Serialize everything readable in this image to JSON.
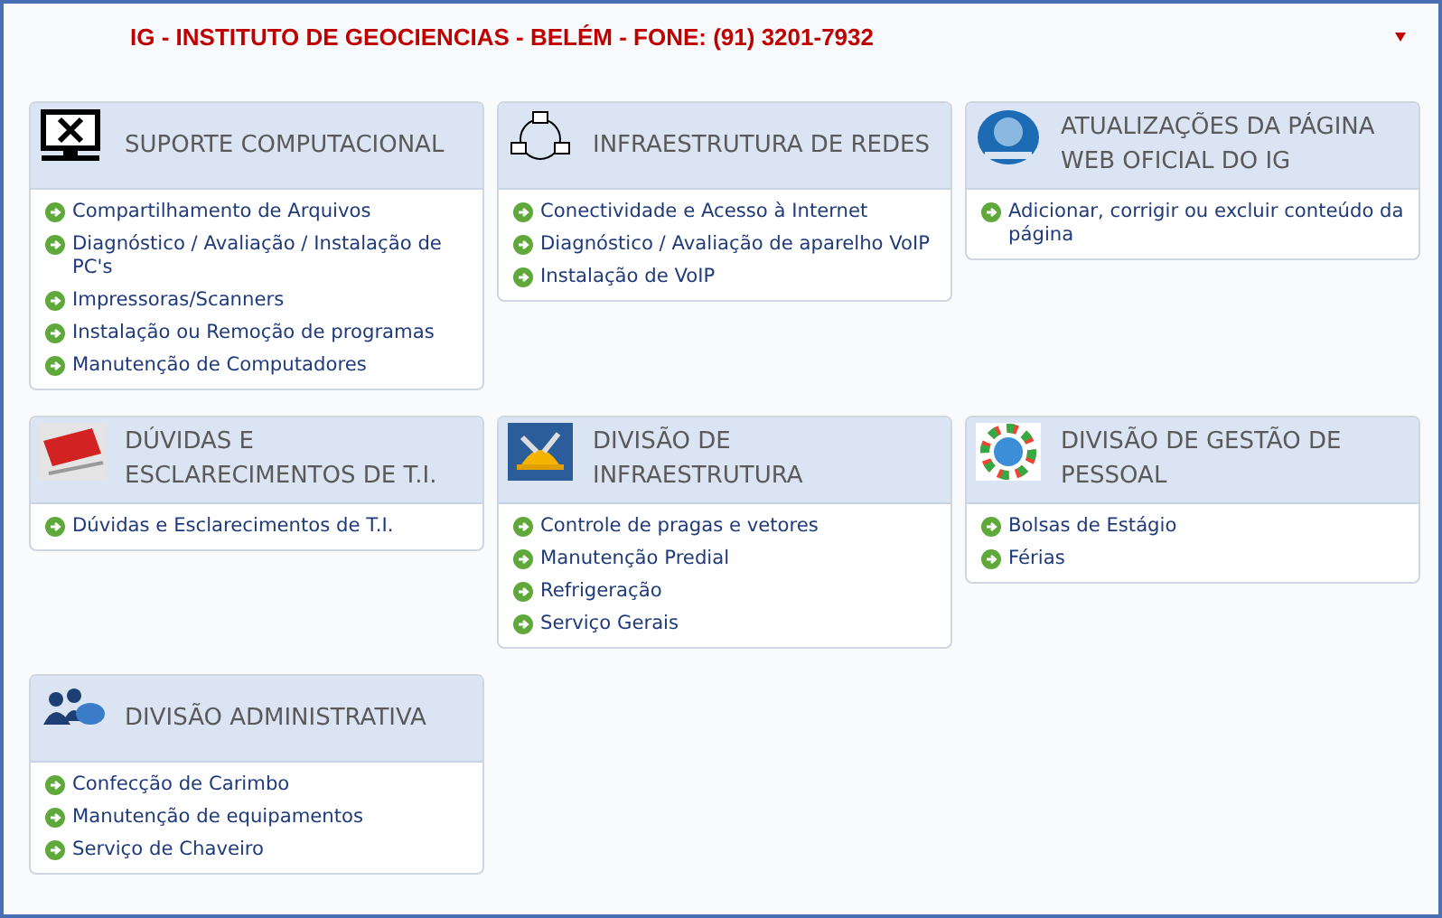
{
  "header": {
    "title": "IG - INSTITUTO DE GEOCIENCIAS - BELÉM - FONE: (91) 3201-7932"
  },
  "cards": [
    {
      "title": "SUPORTE COMPUTACIONAL",
      "links": [
        "Compartilhamento de Arquivos",
        "Diagnóstico / Avaliação / Instalação de PC's",
        "Impressoras/Scanners",
        "Instalação ou Remoção de programas",
        "Manutenção de Computadores"
      ]
    },
    {
      "title": "INFRAESTRUTURA DE REDES",
      "links": [
        "Conectividade e Acesso à Internet",
        "Diagnóstico / Avaliação de aparelho VoIP",
        "Instalação de VoIP"
      ]
    },
    {
      "title": "ATUALIZAÇÕES DA PÁGINA WEB OFICIAL DO IG",
      "links": [
        "Adicionar, corrigir ou excluir conteúdo da página"
      ]
    },
    {
      "title": "DÚVIDAS E ESCLARECIMENTOS DE T.I.",
      "links": [
        "Dúvidas e Esclarecimentos de T.I."
      ]
    },
    {
      "title": "DIVISÃO DE INFRAESTRUTURA",
      "links": [
        "Controle de pragas e vetores",
        "Manutenção Predial",
        "Refrigeração",
        "Serviço Gerais"
      ]
    },
    {
      "title": "DIVISÃO DE GESTÃO DE PESSOAL",
      "links": [
        "Bolsas de Estágio",
        "Férias"
      ]
    },
    {
      "title": "DIVISÃO ADMINISTRATIVA",
      "links": [
        "Confecção de Carimbo",
        "Manutenção de equipamentos",
        "Serviço de Chaveiro"
      ]
    }
  ]
}
